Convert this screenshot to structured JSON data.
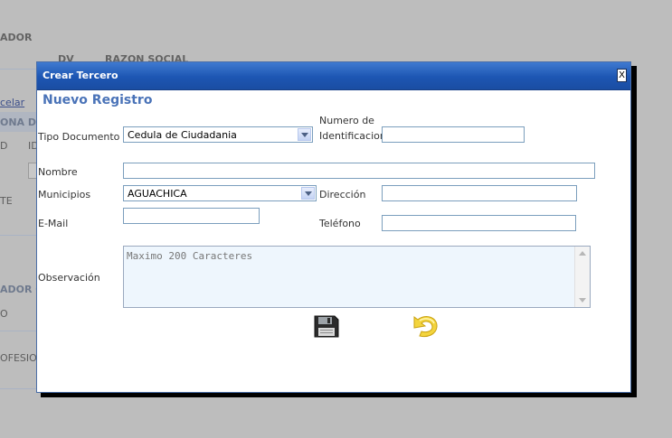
{
  "background": {
    "col_header_left": "ADOR",
    "col_dv": "DV",
    "col_razon_social": "RAZON SOCIAL",
    "link_cancelar": "celar",
    "section_1": "ONA DE",
    "field_d": "D",
    "field_id": "ID",
    "field_te": "TE",
    "section_2": "ADOR O R",
    "field_o": "O",
    "field_profesional": "OFESIONA"
  },
  "modal": {
    "title": "Crear Tercero",
    "close_label": "X",
    "heading": "Nuevo Registro",
    "tipo_documento": {
      "label": "Tipo Documento",
      "value": "Cedula de Ciudadania"
    },
    "numero_identificacion": {
      "label": "Numero de Identificacion",
      "value": ""
    },
    "nombre": {
      "label": "Nombre",
      "value": ""
    },
    "municipios": {
      "label": "Municipios",
      "value": "AGUACHICA"
    },
    "direccion": {
      "label": "Dirección",
      "value": ""
    },
    "email": {
      "label": "E-Mail",
      "value": ""
    },
    "telefono": {
      "label": "Teléfono",
      "value": ""
    },
    "observacion": {
      "label": "Observación",
      "placeholder": "Maximo 200 Caracteres"
    },
    "icons": {
      "save": "floppy-disk-icon",
      "undo": "undo-arrow-icon"
    }
  }
}
